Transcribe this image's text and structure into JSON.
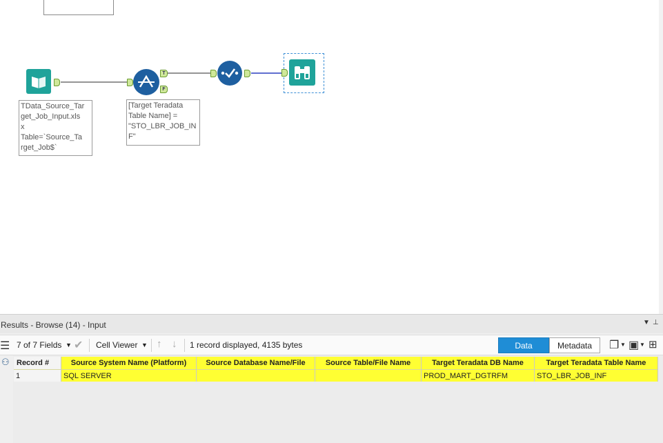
{
  "workflow": {
    "tools": [
      {
        "name": "input-data-tool",
        "annotation": "TData_Source_Tar\nget_Job_Input.xls\nx\nTable=`Source_Ta\nrget_Job$`"
      },
      {
        "name": "filter-tool",
        "annotation": "[Target Teradata\nTable Name] =\n\"STO_LBR_JOB_IN\nF\"",
        "anchor_true": "T",
        "anchor_false": "F"
      },
      {
        "name": "select-tool"
      },
      {
        "name": "browse-tool"
      }
    ]
  },
  "results": {
    "title": "Results - Browse (14) - Input",
    "fields_label": "7 of 7 Fields",
    "cell_viewer_label": "Cell Viewer",
    "status": "1 record displayed, 4135 bytes",
    "tabs": {
      "data": "Data",
      "metadata": "Metadata"
    },
    "columns": [
      "Record #",
      "Source System Name (Platform)",
      "Source Database Name/File",
      "Source Table/File Name",
      "Target Teradata DB Name",
      "Target Teradata Table Name"
    ],
    "rows": [
      [
        "1",
        "SQL SERVER",
        "",
        "",
        "PROD_MART_DGTRFM",
        "STO_LBR_JOB_INF"
      ]
    ]
  },
  "colors": {
    "highlight": "#ffff33",
    "accent": "#1f8dd6",
    "tool_teal": "#1fa39a",
    "tool_blue": "#1e5fa0"
  }
}
